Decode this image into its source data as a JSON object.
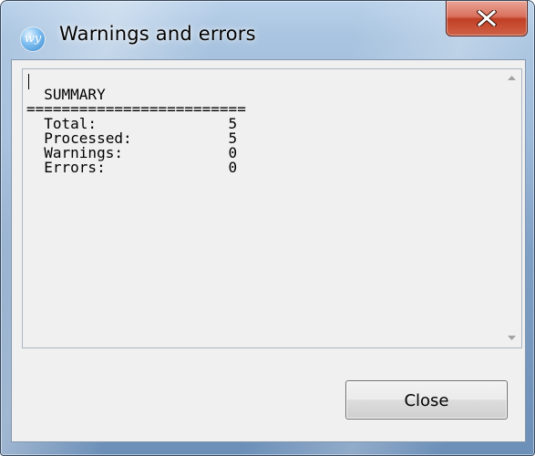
{
  "window": {
    "title": "Warnings and errors",
    "icon": "wy",
    "icon_name": "app-logo-icon",
    "close_icon": "close-icon"
  },
  "output": {
    "lines": [
      "",
      "  SUMMARY",
      "=========================",
      "  Total:               5",
      "  Processed:           5",
      "  Warnings:            0",
      "  Errors:              0"
    ]
  },
  "buttons": {
    "close_label": "Close"
  },
  "colors": {
    "title_close_red": "#c13f25",
    "frame_blue": "#9dbada",
    "client_bg": "#f0f0f0"
  }
}
